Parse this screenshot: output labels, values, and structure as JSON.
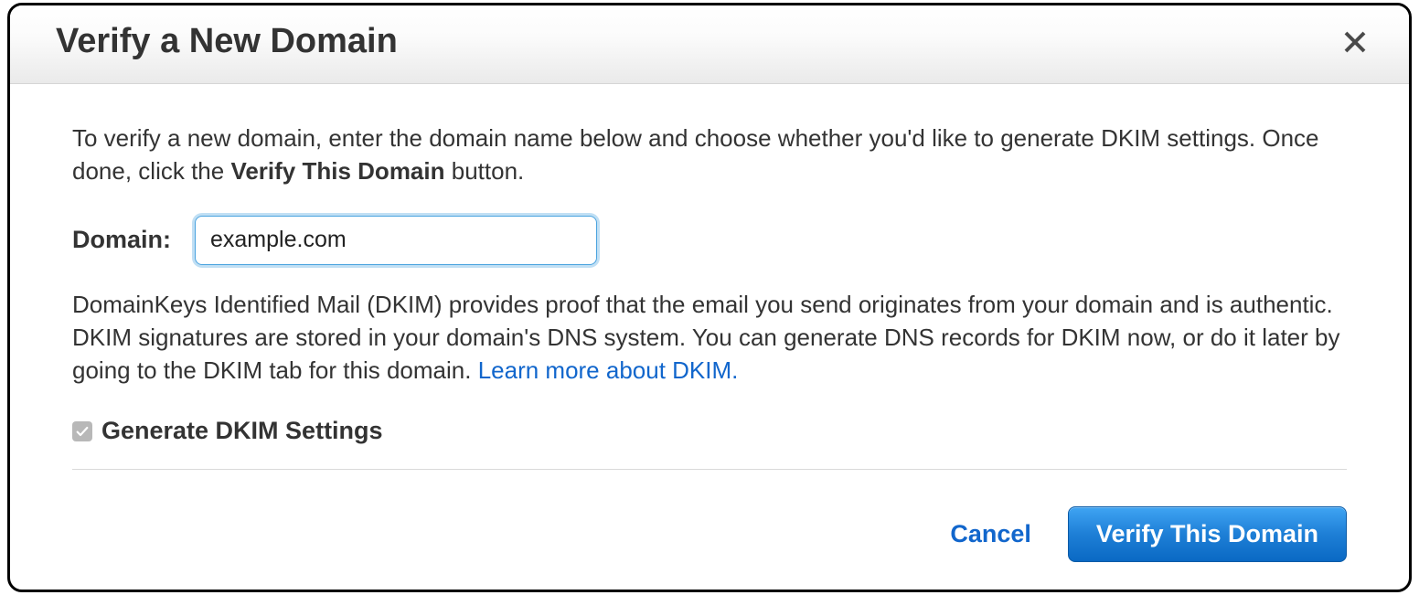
{
  "dialog": {
    "title": "Verify a New Domain",
    "intro_prefix": "To verify a new domain, enter the domain name below and choose whether you'd like to generate DKIM settings. Once done, click the ",
    "intro_bold": "Verify This Domain",
    "intro_suffix": " button.",
    "domain_label": "Domain:",
    "domain_value": "example.com",
    "dkim_text": "DomainKeys Identified Mail (DKIM) provides proof that the email you send originates from your domain and is authentic. DKIM signatures are stored in your domain's DNS system. You can generate DNS records for DKIM now, or do it later by going to the DKIM tab for this domain.  ",
    "dkim_link": "Learn more about DKIM.",
    "checkbox_label": "Generate DKIM Settings",
    "checkbox_checked": true,
    "cancel": "Cancel",
    "submit": "Verify This Domain"
  }
}
